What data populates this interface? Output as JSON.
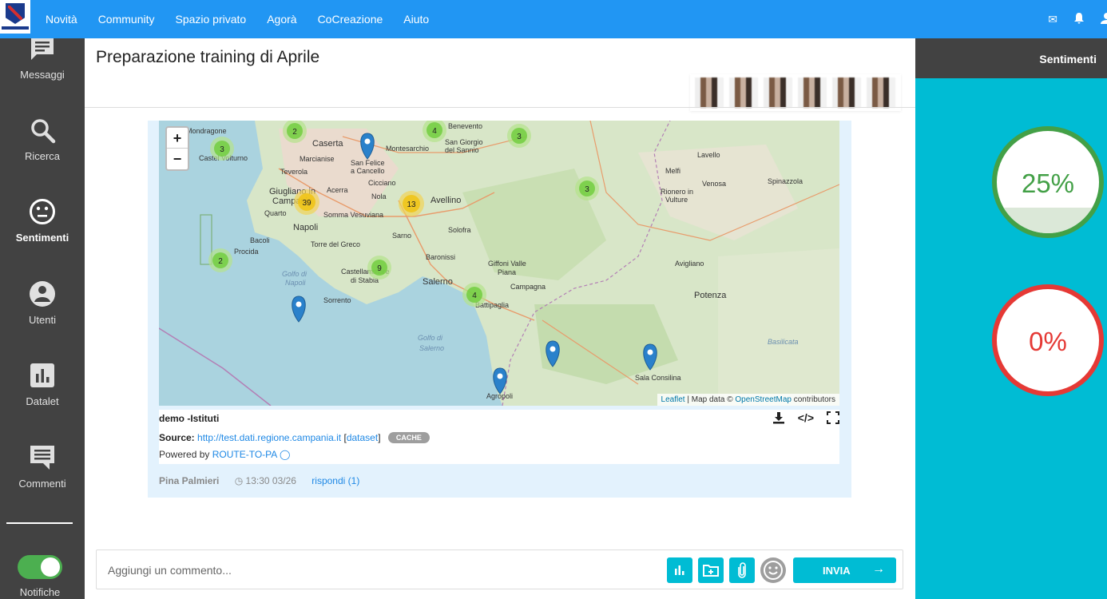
{
  "topbar": {
    "nav": [
      "Novità",
      "Community",
      "Spazio privato",
      "Agorà",
      "CoCreazione",
      "Aiuto"
    ]
  },
  "sidebar": {
    "items": [
      {
        "label": "Messaggi",
        "icon": "message-icon"
      },
      {
        "label": "Ricerca",
        "icon": "search-icon"
      },
      {
        "label": "Sentimenti",
        "icon": "neutral-face-icon",
        "active": true
      },
      {
        "label": "Utenti",
        "icon": "user-icon"
      },
      {
        "label": "Datalet",
        "icon": "chart-icon"
      },
      {
        "label": "Commenti",
        "icon": "comment-icon"
      }
    ],
    "toggle_label": "Notifiche",
    "toggle_on": true
  },
  "main": {
    "title": "Preparazione training di Aprile"
  },
  "datalet": {
    "name": "demo -Istituti",
    "source_label": "Source:",
    "source_url": "http://test.dati.regione.campania.it",
    "dataset_link": "dataset",
    "badge": "CACHE",
    "powered_by": "Powered by",
    "powered_link": "ROUTE-TO-PA",
    "map": {
      "zoom_in": "+",
      "zoom_out": "−",
      "attribution": {
        "leaflet": "Leaflet",
        "mid": " | Map data © ",
        "osm": "OpenStreetMap",
        "end": " contributors"
      },
      "clusters": [
        {
          "count": "2",
          "color": "green"
        },
        {
          "count": "4",
          "color": "green"
        },
        {
          "count": "3",
          "color": "green"
        },
        {
          "count": "3",
          "color": "green"
        },
        {
          "count": "39",
          "color": "yellow"
        },
        {
          "count": "13",
          "color": "yellow"
        },
        {
          "count": "3",
          "color": "green"
        },
        {
          "count": "2",
          "color": "green"
        },
        {
          "count": "9",
          "color": "green"
        },
        {
          "count": "4",
          "color": "green"
        }
      ],
      "places": [
        "Mondragone",
        "Caserta",
        "Montesarchio",
        "San Giorgio del Sannio",
        "Benevento",
        "Lavello",
        "Castel Volturno",
        "Marcianise",
        "San Felice a Cancello",
        "Melfi",
        "Venosa",
        "Spinazzola",
        "Teverola",
        "Cicciano",
        "Rionero in Vulture",
        "Giugliano in Campania",
        "Acerra",
        "Nola",
        "Avellino",
        "Quarto",
        "Somma Vesuviana",
        "Napoli",
        "Solofra",
        "Bacoli",
        "Torre del Greco",
        "Sarno",
        "Procida",
        "Baronissi",
        "Giffoni Valle Piana",
        "Avigliano",
        "Castellammare di Stabia",
        "Salerno",
        "Campagna",
        "Golfo di Napoli",
        "Sorrento",
        "Battipaglia",
        "Potenza",
        "Golfo di Salerno",
        "Basilicata",
        "Sala Consilina",
        "Agropoli"
      ]
    }
  },
  "message": {
    "author": "Pina Palmieri",
    "time": "13:30 03/26",
    "reply": "rispondi (1)"
  },
  "composer": {
    "placeholder": "Aggiungi un commento...",
    "send_label": "INVIA"
  },
  "panel": {
    "title": "Sentimenti",
    "positive": "25%",
    "positive_fraction": 0.25,
    "negative": "0%",
    "negative_fraction": 0.0,
    "positive_color": "#43a047",
    "negative_color": "#e53935"
  }
}
